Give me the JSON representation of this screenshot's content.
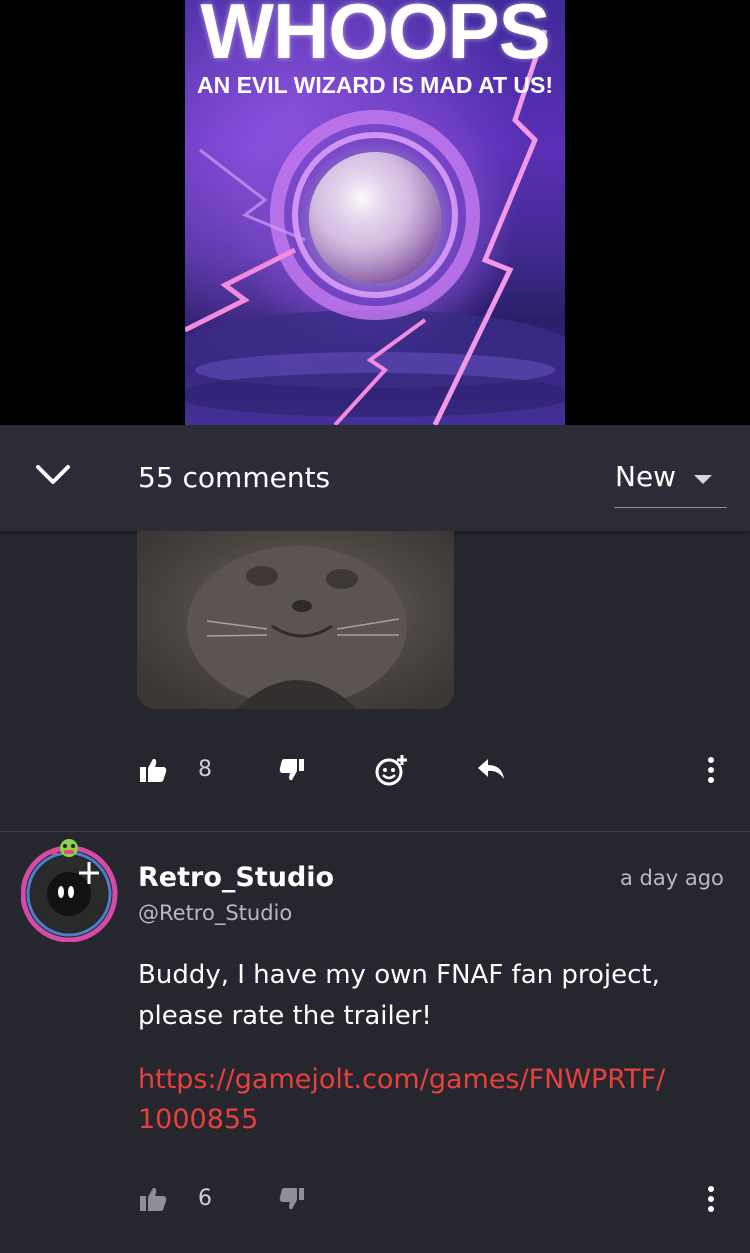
{
  "poster": {
    "title": "WHOOPS",
    "subtitle": "AN EVIL WIZARD IS MAD AT US!"
  },
  "comments_bar": {
    "count_label": "55 comments",
    "sort_value": "New"
  },
  "comments": [
    {
      "like_count": "8"
    },
    {
      "username": "Retro_Studio",
      "handle": "@Retro_Studio",
      "timestamp": "a day ago",
      "body": "Buddy, I have my own FNAF fan project, please rate the trailer!",
      "link_line1": "https://gamejolt.com/games/FNWPRTF/",
      "link_line2": "1000855",
      "like_count": "6"
    }
  ],
  "colors": {
    "background": "#25262e",
    "header_bar": "#2b2c35",
    "link": "#e8413b",
    "avatar_ring": "#d64aa5"
  },
  "icons": [
    "chevron-down-icon",
    "caret-down-icon",
    "thumbs-up-icon",
    "thumbs-down-icon",
    "add-reaction-icon",
    "reply-icon",
    "more-vertical-icon"
  ]
}
